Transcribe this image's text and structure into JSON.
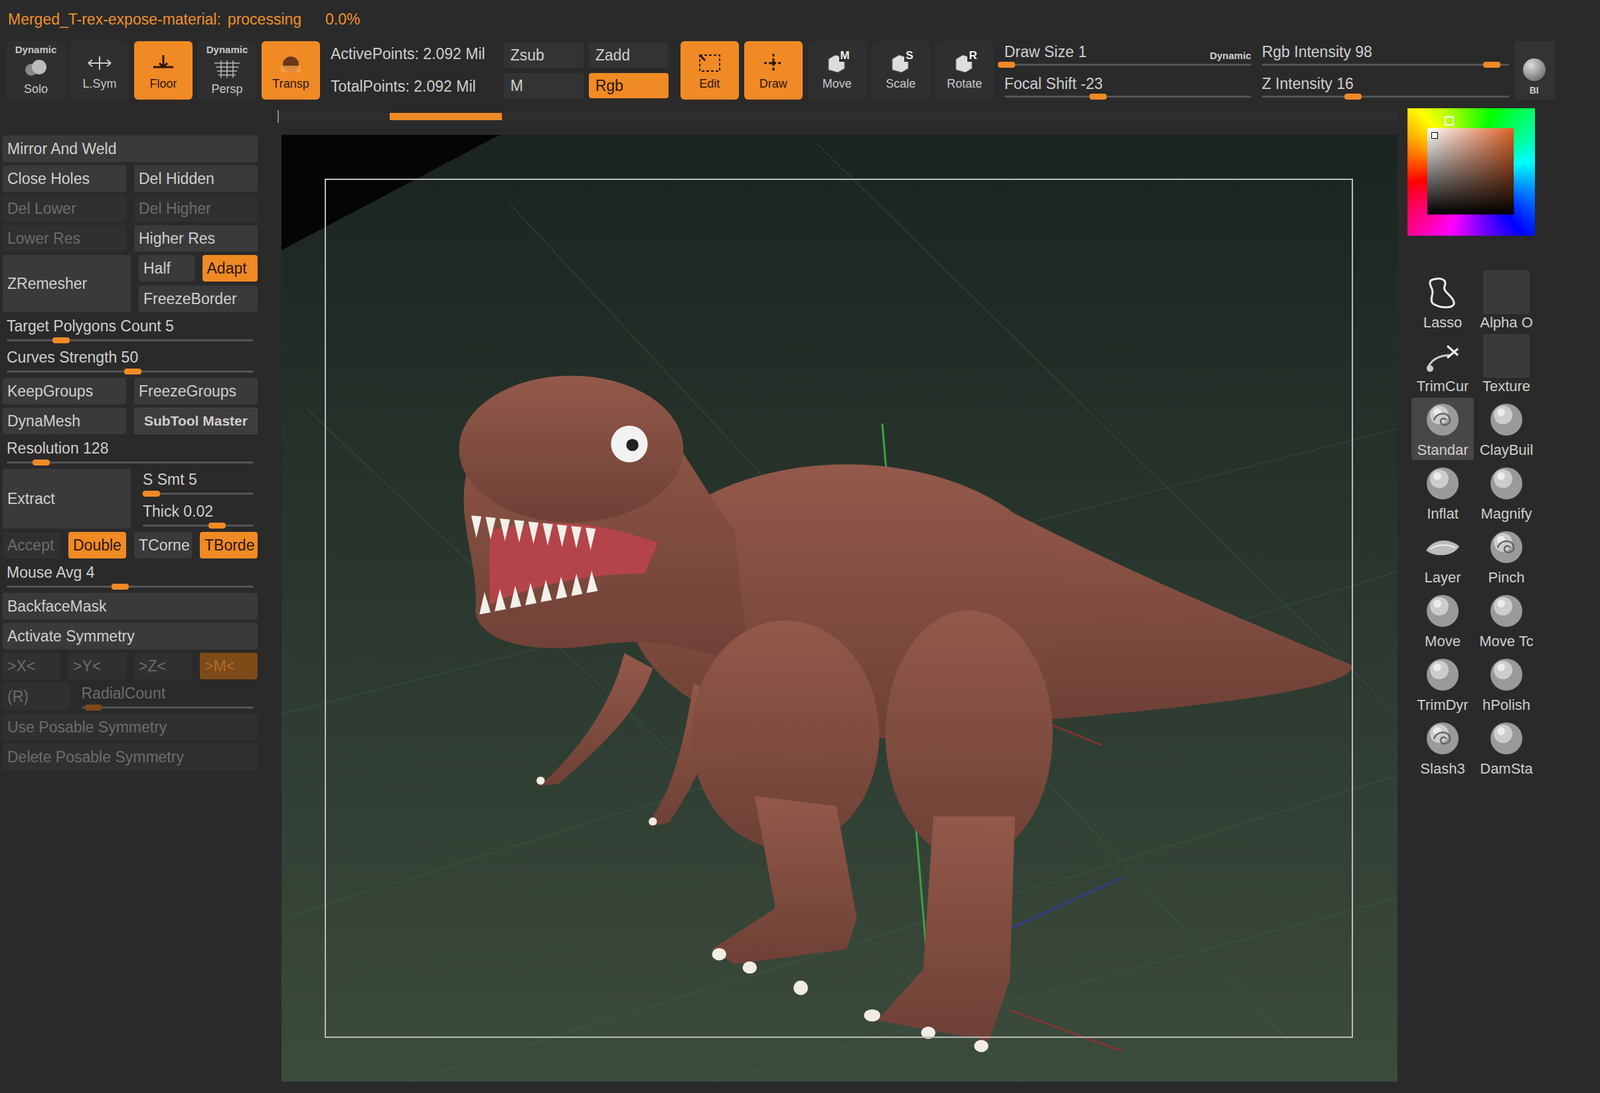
{
  "status": {
    "file": "Merged_T-rex-expose-material:",
    "state": "processing",
    "percent": "0.0%"
  },
  "toolbar": {
    "toggles": [
      {
        "top": "Dynamic",
        "label": "Solo",
        "selected": false,
        "kind": "solo"
      },
      {
        "top": "",
        "label": "L.Sym",
        "selected": false,
        "kind": "lsym"
      },
      {
        "top": "",
        "label": "Floor",
        "selected": true,
        "kind": "floor"
      },
      {
        "top": "Dynamic",
        "label": "Persp",
        "selected": false,
        "kind": "persp"
      },
      {
        "top": "",
        "label": "Transp",
        "selected": true,
        "kind": "transp"
      }
    ],
    "points": [
      "ActivePoints: 2.092 Mil",
      "TotalPoints: 2.092 Mil"
    ],
    "modes": [
      {
        "label": "Zsub",
        "selected": false
      },
      {
        "label": "Zadd",
        "selected": false
      },
      {
        "label": "M",
        "selected": false
      },
      {
        "label": "Rgb",
        "selected": true
      }
    ],
    "tools": [
      {
        "label": "Edit",
        "key": "",
        "selected": true,
        "kind": "edit"
      },
      {
        "label": "Draw",
        "key": "",
        "selected": true,
        "kind": "draw"
      },
      {
        "label": "Move",
        "key": "M",
        "selected": false,
        "kind": "box"
      },
      {
        "label": "Scale",
        "key": "S",
        "selected": false,
        "kind": "box"
      },
      {
        "label": "Rotate",
        "key": "R",
        "selected": false,
        "kind": "box"
      }
    ],
    "dynamic": "Dynamic",
    "sliders": [
      [
        {
          "label": "Draw Size",
          "value": "1",
          "level": 0.01
        },
        {
          "label": "Focal Shift",
          "value": "-23",
          "level": 0.38
        }
      ],
      [
        {
          "label": "Rgb Intensity",
          "value": "98",
          "level": 0.93
        },
        {
          "label": "Z Intensity",
          "value": "16",
          "level": 0.37
        }
      ]
    ],
    "edge": "BI"
  },
  "progress": {
    "start": 0.1,
    "level": 0.1
  },
  "left_panel": [
    [
      {
        "kind": "button",
        "label": "Mirror And Weld",
        "selected": false,
        "disabled": false
      }
    ],
    [
      {
        "kind": "button",
        "label": "Close Holes",
        "selected": false,
        "disabled": false
      },
      {
        "kind": "button",
        "label": "Del Hidden",
        "selected": false,
        "disabled": false
      }
    ],
    [
      {
        "kind": "button",
        "label": "Del Lower",
        "selected": false,
        "disabled": true
      },
      {
        "kind": "button",
        "label": "Del Higher",
        "selected": false,
        "disabled": true
      }
    ],
    [
      {
        "kind": "button",
        "label": "Lower Res",
        "selected": false,
        "disabled": true
      },
      {
        "kind": "button",
        "label": "Higher Res",
        "selected": false,
        "disabled": false
      }
    ],
    [
      {
        "kind": "button",
        "label": "ZRemesher",
        "selected": false,
        "disabled": false
      },
      {
        "kind": "stack",
        "rows": [
          [
            {
              "kind": "button",
              "label": "Half",
              "selected": false,
              "disabled": false
            },
            {
              "kind": "button",
              "label": "Adapt",
              "selected": true,
              "disabled": false
            }
          ],
          [
            {
              "kind": "button",
              "label": "FreezeBorder",
              "selected": false,
              "disabled": false
            }
          ]
        ]
      }
    ],
    [
      {
        "kind": "slider",
        "label": "Target Polygons Count",
        "value": "5",
        "level": 0.22,
        "disabled": false
      }
    ],
    [
      {
        "kind": "slider",
        "label": "Curves Strength",
        "value": "50",
        "level": 0.51,
        "disabled": false
      }
    ],
    [
      {
        "kind": "button",
        "label": "KeepGroups",
        "selected": false,
        "disabled": false
      },
      {
        "kind": "button",
        "label": "FreezeGroups",
        "selected": false,
        "disabled": false
      }
    ],
    [
      {
        "kind": "button",
        "label": "DynaMesh",
        "selected": false,
        "disabled": false
      },
      {
        "kind": "multi",
        "label": "SubTool Master",
        "selected": false,
        "disabled": false
      }
    ],
    [
      {
        "kind": "slider",
        "label": "Resolution",
        "value": "128",
        "level": 0.14,
        "disabled": false
      }
    ],
    [
      {
        "kind": "button",
        "label": "Extract",
        "selected": false,
        "disabled": false
      },
      {
        "kind": "stack",
        "rows": [
          [
            {
              "kind": "slider",
              "label": "S Smt",
              "value": "5",
              "level": 0.08,
              "disabled": false
            }
          ],
          [
            {
              "kind": "slider",
              "label": "Thick",
              "value": "0.02",
              "level": 0.67,
              "disabled": false
            }
          ]
        ]
      }
    ],
    [
      {
        "kind": "button",
        "label": "Accept",
        "selected": false,
        "disabled": true
      },
      {
        "kind": "button",
        "label": "Double",
        "selected": true,
        "disabled": false
      },
      {
        "kind": "button",
        "label": "TCorne",
        "selected": false,
        "disabled": false
      },
      {
        "kind": "button",
        "label": "TBorde",
        "selected": true,
        "disabled": false
      }
    ],
    [
      {
        "kind": "slider",
        "label": "Mouse Avg",
        "value": "4",
        "level": 0.46,
        "disabled": false
      }
    ],
    [
      {
        "kind": "button",
        "label": "BackfaceMask",
        "selected": false,
        "disabled": false
      }
    ],
    [
      {
        "kind": "button",
        "label": "Activate Symmetry",
        "selected": false,
        "disabled": false
      }
    ],
    [
      {
        "kind": "button",
        "label": ">X<",
        "selected": false,
        "disabled": true
      },
      {
        "kind": "button",
        "label": ">Y<",
        "selected": false,
        "disabled": true
      },
      {
        "kind": "button",
        "label": ">Z<",
        "selected": false,
        "disabled": true
      },
      {
        "kind": "button",
        "label": ">M<",
        "selected": true,
        "disabled": true
      }
    ],
    [
      {
        "kind": "button",
        "label": "(R)",
        "selected": false,
        "disabled": true
      },
      {
        "kind": "slider",
        "label": "RadialCount",
        "value": "",
        "level": 0.07,
        "disabled": true
      }
    ],
    [
      {
        "kind": "button",
        "label": "Use Posable Symmetry",
        "selected": false,
        "disabled": true
      }
    ],
    [
      {
        "kind": "button",
        "label": "Delete Posable Symmetry",
        "selected": false,
        "disabled": true
      }
    ]
  ],
  "color_picker": {
    "color": "#e0622a"
  },
  "brushes": [
    {
      "label": "Lasso",
      "kind": "lasso",
      "selected": false
    },
    {
      "label": "Alpha O",
      "kind": "empty",
      "selected": false
    },
    {
      "label": "TrimCur",
      "kind": "trim",
      "selected": false
    },
    {
      "label": "Texture",
      "kind": "empty",
      "selected": false
    },
    {
      "label": "Standar",
      "kind": "swirl",
      "selected": true
    },
    {
      "label": "ClayBuil",
      "kind": "sphere",
      "selected": false
    },
    {
      "label": "Inflat",
      "kind": "sphere",
      "selected": false
    },
    {
      "label": "Magnify",
      "kind": "sphere",
      "selected": false
    },
    {
      "label": "Layer",
      "kind": "layer",
      "selected": false
    },
    {
      "label": "Pinch",
      "kind": "swirl",
      "selected": false
    },
    {
      "label": "Move",
      "kind": "sphere",
      "selected": false
    },
    {
      "label": "Move Tc",
      "kind": "sphere",
      "selected": false
    },
    {
      "label": "TrimDyr",
      "kind": "sphere",
      "selected": false
    },
    {
      "label": "hPolish",
      "kind": "sphere",
      "selected": false
    },
    {
      "label": "Slash3",
      "kind": "swirl",
      "selected": false
    },
    {
      "label": "DamSta",
      "kind": "sphere",
      "selected": false
    }
  ]
}
